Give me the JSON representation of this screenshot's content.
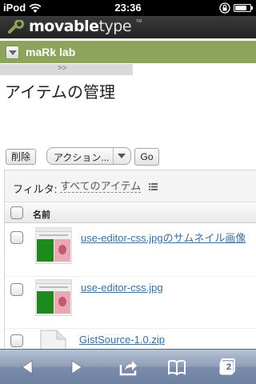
{
  "status_bar": {
    "carrier": "iPod",
    "time": "23:36",
    "battery_level": 0.8
  },
  "app": {
    "logo_text_bold": "movable",
    "logo_text_light": "type",
    "logo_tm": "TM"
  },
  "blog": {
    "name": "maRk lab"
  },
  "collapse_strip": {
    "label": ">>"
  },
  "page": {
    "title": "アイテムの管理"
  },
  "actions": {
    "delete_label": "削除",
    "select_value": "アクション...",
    "go_label": "Go"
  },
  "filter": {
    "label": "フィルタ:",
    "value": "すべてのアイテム"
  },
  "table": {
    "column_name": "名前",
    "rows": [
      {
        "name": "use-editor-css.jpgのサムネイル画像",
        "type": "image"
      },
      {
        "name": "use-editor-css.jpg",
        "type": "image"
      },
      {
        "name": "GistSource-1.0.zip",
        "type": "file"
      }
    ]
  },
  "toolbar": {
    "tabs_count": "2"
  },
  "colors": {
    "header_bg": "#2b2b2b",
    "blog_bar": "#8ca45c",
    "link": "#3b6f9f",
    "toolbar": "#7b8cab"
  },
  "icons": {
    "back": "back-arrow-icon",
    "forward": "forward-arrow-icon",
    "share": "share-icon",
    "bookmarks": "bookmarks-book-icon",
    "tabs": "tabs-icon",
    "wifi": "wifi-icon",
    "lock": "rotation-lock-icon",
    "battery": "battery-icon",
    "filter_list": "list-icon",
    "logo": "movabletype-logo-icon"
  }
}
